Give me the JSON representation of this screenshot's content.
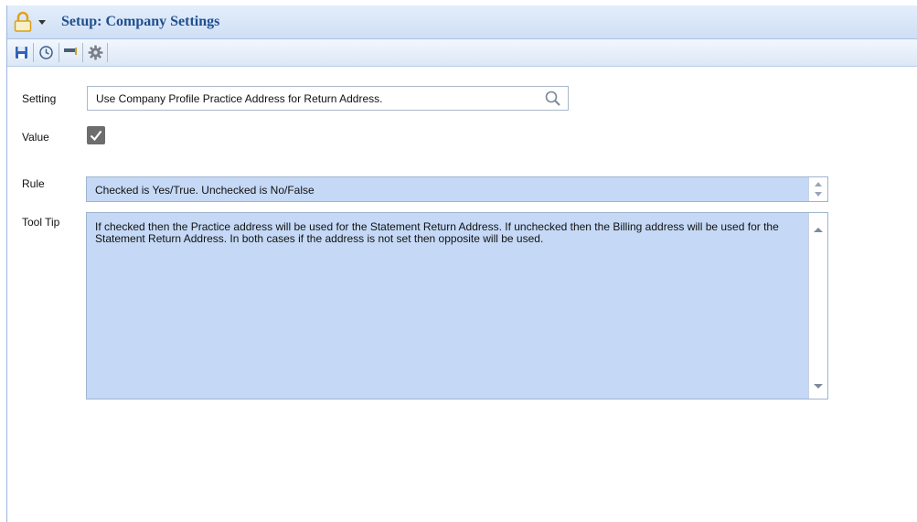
{
  "window": {
    "title": "Setup: Company Settings"
  },
  "toolbar": {
    "buttons": [
      {
        "icon": "save-icon"
      },
      {
        "icon": "history-icon"
      },
      {
        "icon": "flag-icon"
      },
      {
        "icon": "gear-icon"
      }
    ]
  },
  "form": {
    "setting_label": "Setting",
    "setting_value": "Use Company Profile Practice Address for Return Address.",
    "value_label": "Value",
    "value_checked": true,
    "rule_label": "Rule",
    "rule_text": "Checked is Yes/True. Unchecked is No/False",
    "tooltip_label": "Tool Tip",
    "tooltip_text": "If checked then the Practice address will be used for the Statement Return Address.  If unchecked then the Billing address will be used for the Statement Return Address.  In both cases if the address is not set then opposite will be used."
  },
  "colors": {
    "title": "#1f4e8f",
    "field_background": "#c5d9f6",
    "checkbox": "#6d6d6d"
  }
}
